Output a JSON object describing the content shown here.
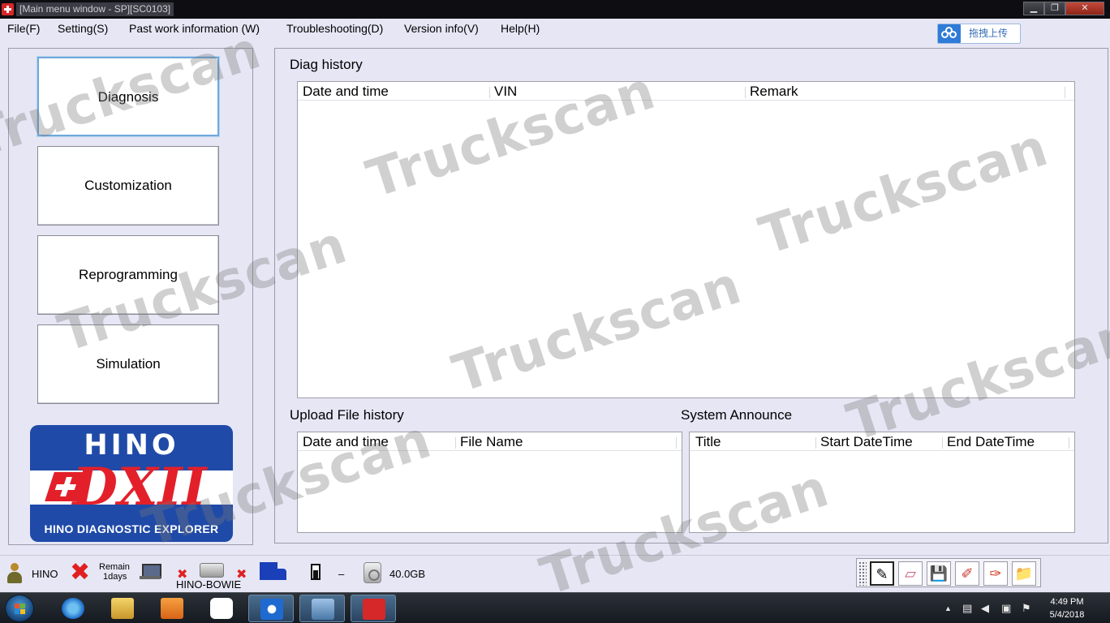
{
  "titlebar": {
    "title": "[Main menu window - SP][SC0103]",
    "minimize_icon": "minimize-icon",
    "maximize_icon": "maximize-icon",
    "close_icon": "close-icon",
    "min_glyph": "▁",
    "max_glyph": "❐",
    "close_glyph": "✕"
  },
  "menu": {
    "items": [
      "File(F)",
      "Setting(S)",
      "Past work information (W)",
      "Troubleshooting(D)",
      "Version info(V)",
      "Help(H)"
    ],
    "upload_label": "拖拽上传"
  },
  "nav": {
    "buttons": [
      "Diagnosis",
      "Customization",
      "Reprogramming",
      "Simulation"
    ],
    "active": "Diagnosis"
  },
  "logo": {
    "brand": "HINO",
    "product": "DXII",
    "subtitle": "HINO DIAGNOSTIC EXPLORER"
  },
  "diag_history": {
    "label": "Diag history",
    "columns": [
      "Date and time",
      "VIN",
      "Remark"
    ],
    "rows": []
  },
  "upload_history": {
    "label": "Upload File history",
    "columns": [
      "Date and time",
      "File Name"
    ],
    "rows": []
  },
  "system_announce": {
    "label": "System Announce",
    "columns": [
      "Title",
      "Start DateTime",
      "End DateTime"
    ],
    "rows": []
  },
  "statusbar": {
    "user": "HINO",
    "remain_line1": "Remain",
    "remain_line2": "1days",
    "device": "HINO-BOWIE",
    "dash": "–",
    "disk": "40.0GB",
    "x_glyph": "✖"
  },
  "toolbar": {
    "tools": [
      "pencil-icon",
      "eraser-icon",
      "save-icon",
      "brush-icon",
      "paint-icon",
      "folder-icon"
    ],
    "glyphs": [
      "✎",
      "▱",
      "💾",
      "✐",
      "✑",
      "📁"
    ]
  },
  "watermark": "Truckscan",
  "taskbar": {
    "apps": [
      "internet-explorer-icon",
      "file-explorer-icon",
      "media-player-icon",
      "baidu-netdisk-icon",
      "teamviewer-icon",
      "remote-desktop-icon",
      "hino-dx2-icon"
    ],
    "time": "4:49 PM",
    "date": "5/4/2018",
    "tray_up": "▲"
  },
  "colors": {
    "window_bg": "#e6e6f5",
    "accent": "#6fa8dc",
    "logo_blue": "#1f4aa8",
    "logo_red": "#e3202a"
  }
}
